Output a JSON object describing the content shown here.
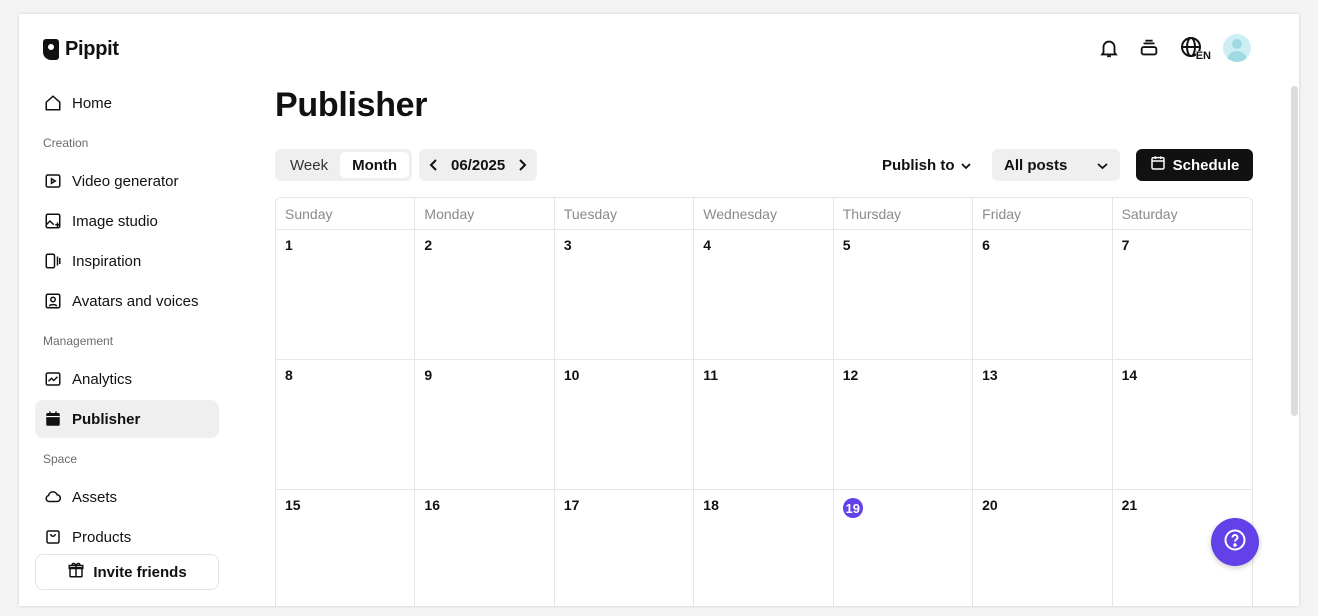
{
  "app": {
    "name": "Pippit"
  },
  "header": {
    "language_badge": "EN"
  },
  "sidebar": {
    "home": "Home",
    "sections": {
      "creation": "Creation",
      "management": "Management",
      "space": "Space"
    },
    "creation_items": [
      "Video generator",
      "Image studio",
      "Inspiration",
      "Avatars and voices"
    ],
    "management_items": [
      "Analytics",
      "Publisher"
    ],
    "space_items": [
      "Assets",
      "Products"
    ],
    "invite": "Invite friends",
    "active_item": "Publisher"
  },
  "main": {
    "title": "Publisher",
    "view_toggle": [
      "Week",
      "Month"
    ],
    "active_view": "Month",
    "current_month": "06/2025",
    "publish_to": "Publish to",
    "filter": "All posts",
    "schedule": "Schedule"
  },
  "calendar": {
    "weekdays": [
      "Sunday",
      "Monday",
      "Tuesday",
      "Wednesday",
      "Thursday",
      "Friday",
      "Saturday"
    ],
    "days": [
      "1",
      "2",
      "3",
      "4",
      "5",
      "6",
      "7",
      "8",
      "9",
      "10",
      "11",
      "12",
      "13",
      "14",
      "15",
      "16",
      "17",
      "18",
      "19",
      "20",
      "21"
    ],
    "today": "19"
  },
  "colors": {
    "accent": "#6241e8",
    "primary_button": "#111111"
  }
}
